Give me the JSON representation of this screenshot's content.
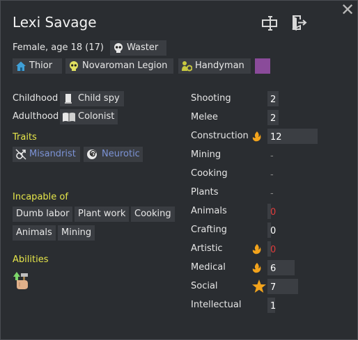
{
  "header": {
    "name": "Lexi Savage",
    "close_icon": "close-icon",
    "rename_icon": "rename-icon",
    "banish_icon": "banish-icon"
  },
  "identity": {
    "description": "Female, age 18 (17)",
    "xenotype": "Waster",
    "faction_home": "Thior",
    "faction": "Novaroman Legion",
    "role": "Handyman",
    "favorite_color": "#8a4b9a"
  },
  "backstory": {
    "childhood_label": "Childhood",
    "childhood": "Child spy",
    "adulthood_label": "Adulthood",
    "adulthood": "Colonist"
  },
  "traits": {
    "title": "Traits",
    "items": [
      "Misandrist",
      "Neurotic"
    ]
  },
  "incapable": {
    "title": "Incapable of",
    "items": [
      "Dumb labor",
      "Plant work",
      "Cooking",
      "Animals",
      "Mining"
    ]
  },
  "abilities": {
    "title": "Abilities",
    "icon": "ability-icon"
  },
  "skills": [
    {
      "name": "Shooting",
      "value": "2",
      "level": 2,
      "passion": "none",
      "state": "normal"
    },
    {
      "name": "Melee",
      "value": "2",
      "level": 2,
      "passion": "none",
      "state": "normal"
    },
    {
      "name": "Construction",
      "value": "12",
      "level": 12,
      "passion": "minor",
      "state": "normal"
    },
    {
      "name": "Mining",
      "value": "-",
      "level": 0,
      "passion": "none",
      "state": "disabled"
    },
    {
      "name": "Cooking",
      "value": "-",
      "level": 0,
      "passion": "none",
      "state": "disabled"
    },
    {
      "name": "Plants",
      "value": "-",
      "level": 0,
      "passion": "none",
      "state": "disabled"
    },
    {
      "name": "Animals",
      "value": "0",
      "level": 0,
      "passion": "none",
      "state": "red"
    },
    {
      "name": "Crafting",
      "value": "0",
      "level": 0,
      "passion": "none",
      "state": "normal"
    },
    {
      "name": "Artistic",
      "value": "0",
      "level": 0,
      "passion": "minor",
      "state": "red"
    },
    {
      "name": "Medical",
      "value": "6",
      "level": 6,
      "passion": "minor",
      "state": "normal"
    },
    {
      "name": "Social",
      "value": "7",
      "level": 7,
      "passion": "major",
      "state": "normal"
    },
    {
      "name": "Intellectual",
      "value": "1",
      "level": 1,
      "passion": "none",
      "state": "normal"
    }
  ]
}
